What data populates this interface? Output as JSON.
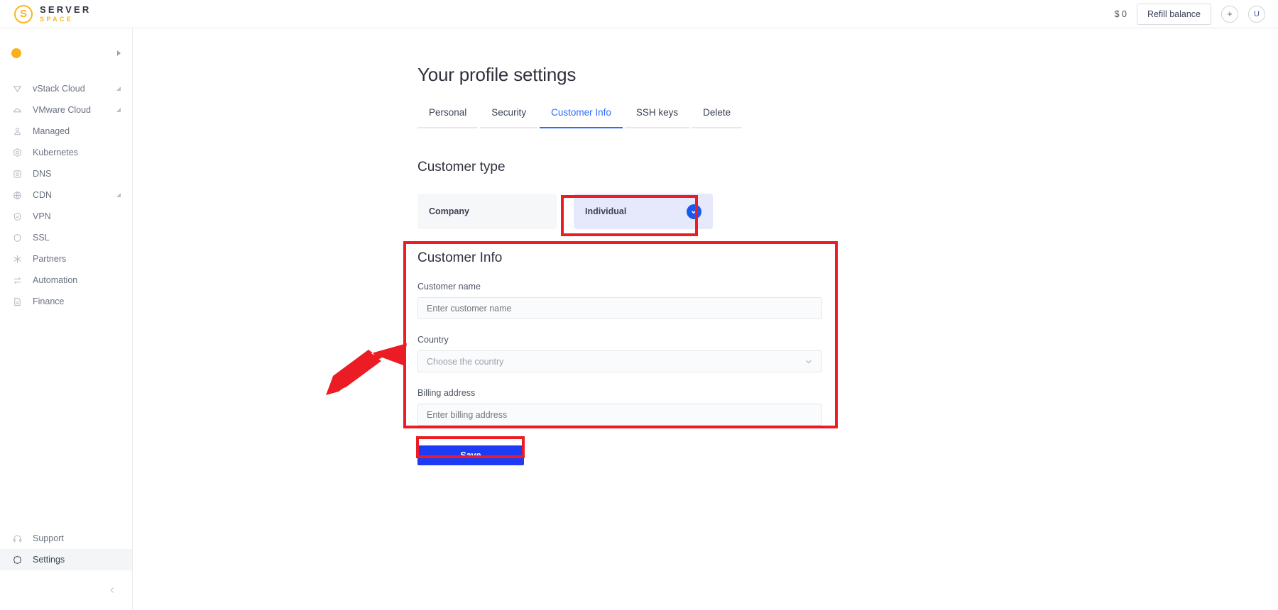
{
  "header": {
    "logo_top": "SERVER",
    "logo_bottom": "SPACE",
    "logo_mark": "logo-s-icon",
    "balance": "$ 0",
    "refill_label": "Refill balance",
    "add_label": "+",
    "avatar_label": "U"
  },
  "sidebar": {
    "account": {
      "label": "",
      "icon": "orange-dot-icon",
      "arrow": "chevron-right-icon"
    },
    "items": [
      {
        "label": "vStack Cloud",
        "icon": "vstack-icon",
        "expandable": true,
        "active": false
      },
      {
        "label": "VMware Cloud",
        "icon": "cloud-icon",
        "expandable": true,
        "active": false
      },
      {
        "label": "Managed",
        "icon": "managed-icon",
        "expandable": false,
        "active": false
      },
      {
        "label": "Kubernetes",
        "icon": "kubernetes-icon",
        "expandable": false,
        "active": false
      },
      {
        "label": "DNS",
        "icon": "dns-icon",
        "expandable": false,
        "active": false
      },
      {
        "label": "CDN",
        "icon": "globe-icon",
        "expandable": true,
        "active": false
      },
      {
        "label": "VPN",
        "icon": "vpn-icon",
        "expandable": false,
        "active": false
      },
      {
        "label": "SSL",
        "icon": "shield-icon",
        "expandable": false,
        "active": false
      },
      {
        "label": "Partners",
        "icon": "partners-icon",
        "expandable": false,
        "active": false
      },
      {
        "label": "Automation",
        "icon": "automation-icon",
        "expandable": false,
        "active": false
      },
      {
        "label": "Finance",
        "icon": "finance-icon",
        "expandable": false,
        "active": false
      }
    ],
    "bottom_items": [
      {
        "label": "Support",
        "icon": "headset-icon",
        "active": false
      },
      {
        "label": "Settings",
        "icon": "gear-icon",
        "active": true
      }
    ],
    "collapse_icon": "chevron-left-icon"
  },
  "main": {
    "page_title": "Your profile settings",
    "tabs": [
      {
        "label": "Personal",
        "active": false
      },
      {
        "label": "Security",
        "active": false
      },
      {
        "label": "Customer Info",
        "active": true
      },
      {
        "label": "SSH keys",
        "active": false
      },
      {
        "label": "Delete",
        "active": false
      }
    ],
    "customer_type": {
      "title": "Customer type",
      "options": [
        {
          "label": "Company",
          "selected": false
        },
        {
          "label": "Individual",
          "selected": true
        }
      ],
      "check_icon": "check-circle-icon"
    },
    "customer_info": {
      "title": "Customer Info",
      "fields": [
        {
          "label": "Customer name",
          "value": "",
          "placeholder": "Enter customer name",
          "type": "text"
        },
        {
          "label": "Country",
          "value": "",
          "placeholder": "Choose the country",
          "type": "select"
        },
        {
          "label": "Billing address",
          "value": "",
          "placeholder": "Enter billing address",
          "type": "text"
        }
      ],
      "chevron_icon": "chevron-down-icon"
    },
    "save_label": "Save"
  },
  "annotations": {
    "color": "#ec1c24",
    "arrow": "red-arrow-pointing-to-country-field",
    "boxes": [
      "individual-card",
      "customer-info-panel",
      "save-button"
    ]
  },
  "colors": {
    "accent_blue": "#2f6bff",
    "save_blue": "#1d3bf5",
    "brand_yellow": "#fcb61a",
    "annotation_red": "#ec1c24",
    "selected_card": "#e6e9fb"
  }
}
